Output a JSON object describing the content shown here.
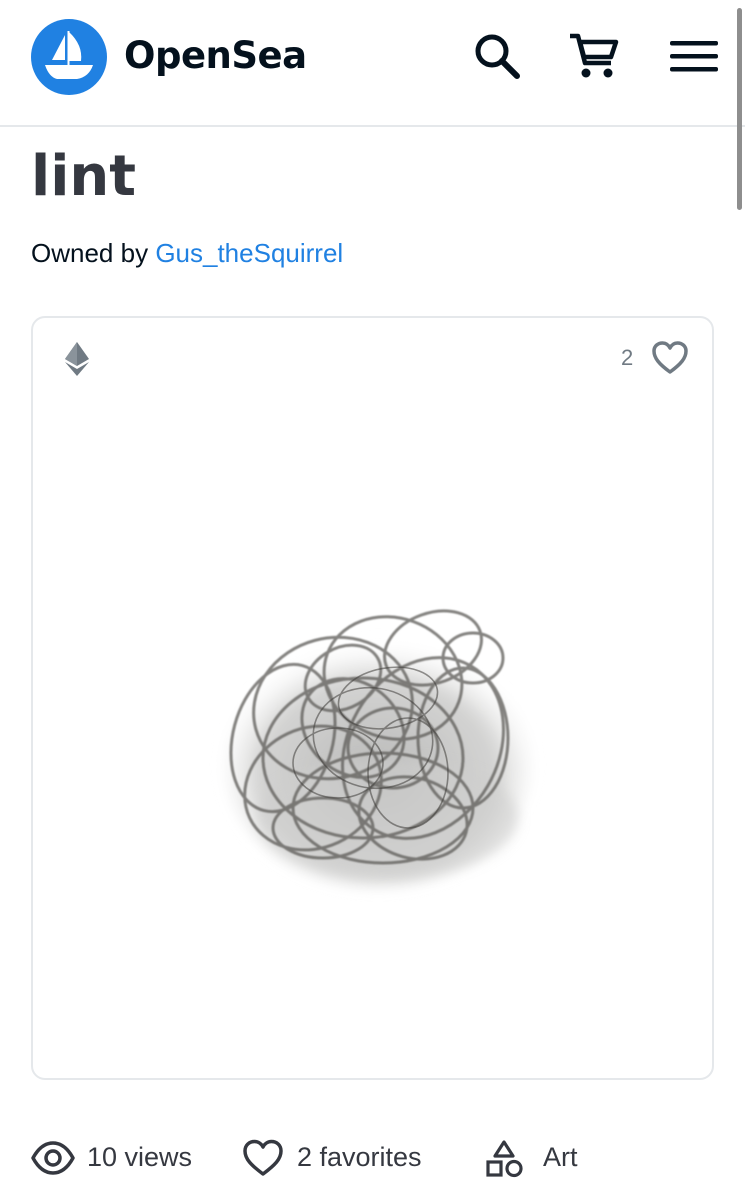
{
  "header": {
    "brand_name": "OpenSea",
    "brand_color": "#2081e2",
    "icons": [
      "ship-logo-icon",
      "search-icon",
      "cart-icon",
      "menu-icon"
    ]
  },
  "item": {
    "title": "lint",
    "owned_by_label": "Owned by",
    "owner_name": "Gus_theSquirrel"
  },
  "card": {
    "chain_icon": "ethereum-icon",
    "favorites_count": "2"
  },
  "stats": {
    "views": "10 views",
    "favorites": "2 favorites",
    "category": "Art"
  }
}
